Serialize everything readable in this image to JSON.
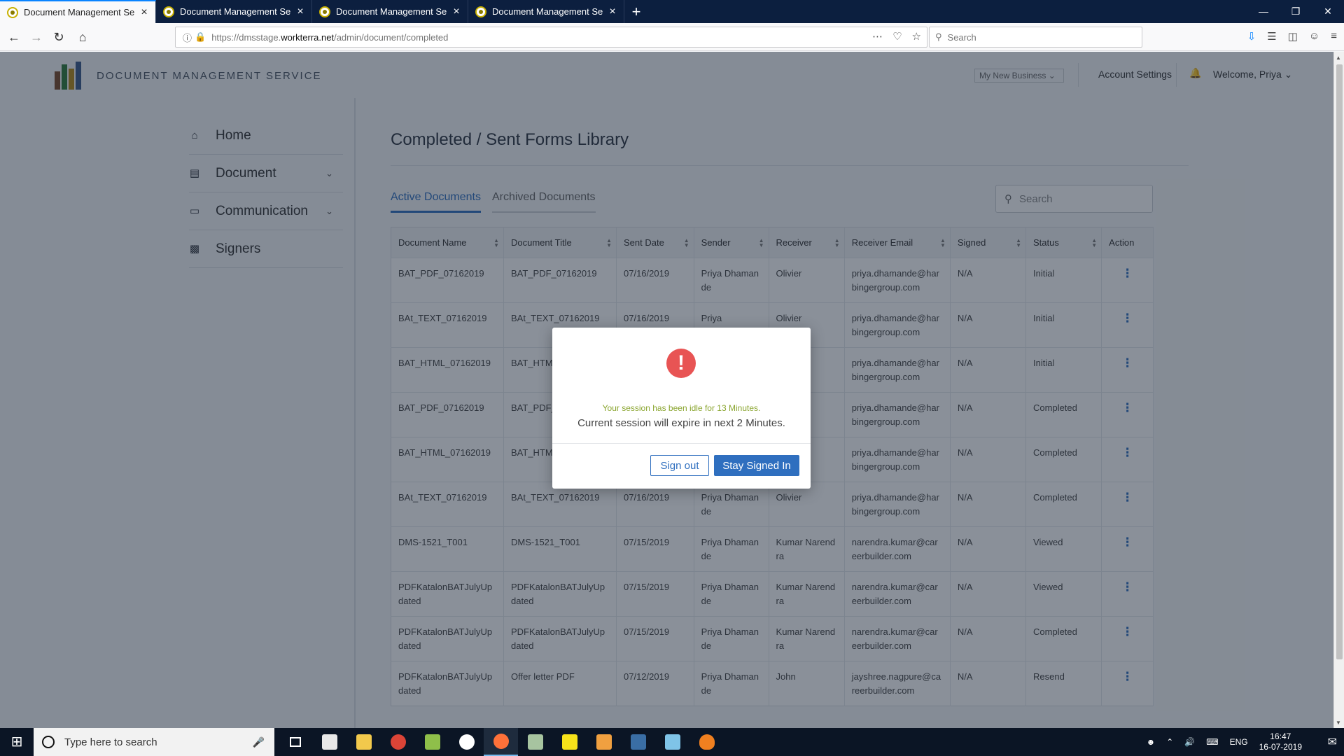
{
  "browser": {
    "tabs": [
      {
        "title": "Document Management Servic",
        "active": true
      },
      {
        "title": "Document Management Servic",
        "active": false
      },
      {
        "title": "Document Management Servic",
        "active": false
      },
      {
        "title": "Document Management Servic",
        "active": false
      }
    ],
    "url_prefix": "https://dmsstage.",
    "url_domain": "workterra.net",
    "url_path": "/admin/document/completed",
    "search_placeholder": "Search"
  },
  "app": {
    "brand": "DOCUMENT MANAGEMENT SERVICE",
    "business_selector": "My New Business",
    "account_settings": "Account Settings",
    "welcome": "Welcome, Priya"
  },
  "sidebar": {
    "items": [
      {
        "label": "Home",
        "icon": "home-icon",
        "expandable": false
      },
      {
        "label": "Document",
        "icon": "document-icon",
        "expandable": true
      },
      {
        "label": "Communication",
        "icon": "chat-icon",
        "expandable": true
      },
      {
        "label": "Signers",
        "icon": "id-card-icon",
        "expandable": false
      }
    ]
  },
  "main": {
    "title": "Completed / Sent Forms Library",
    "tabs": [
      {
        "label": "Active Documents",
        "active": true
      },
      {
        "label": "Archived Documents",
        "active": false
      }
    ],
    "search_placeholder": "Search",
    "columns": [
      "Document Name",
      "Document Title",
      "Sent Date",
      "Sender",
      "Receiver",
      "Receiver Email",
      "Signed",
      "Status",
      "Action"
    ],
    "rows": [
      [
        "BAT_PDF_07162019",
        "BAT_PDF_07162019",
        "07/16/2019",
        "Priya Dhamande",
        "Olivier",
        "priya.dhamande@harbingergroup.com",
        "N/A",
        "Initial"
      ],
      [
        "BAt_TEXT_07162019",
        "BAt_TEXT_07162019",
        "07/16/2019",
        "Priya",
        "Olivier",
        "priya.dhamande@harbingergroup.com",
        "N/A",
        "Initial"
      ],
      [
        "BAT_HTML_07162019",
        "BAT_HTM",
        "",
        "",
        "",
        "priya.dhamande@harbingergroup.com",
        "N/A",
        "Initial"
      ],
      [
        "BAT_PDF_07162019",
        "BAT_PDF_",
        "",
        "",
        "",
        "priya.dhamande@harbingergroup.com",
        "N/A",
        "Completed"
      ],
      [
        "BAT_HTML_07162019",
        "BAT_HTM",
        "",
        "",
        "",
        "priya.dhamande@harbingergroup.com",
        "N/A",
        "Completed"
      ],
      [
        "BAt_TEXT_07162019",
        "BAt_TEXT_07162019",
        "07/16/2019",
        "Priya Dhamande",
        "Olivier",
        "priya.dhamande@harbingergroup.com",
        "N/A",
        "Completed"
      ],
      [
        "DMS-1521_T001",
        "DMS-1521_T001",
        "07/15/2019",
        "Priya Dhamande",
        "Kumar Narendra",
        "narendra.kumar@careerbuilder.com",
        "N/A",
        "Viewed"
      ],
      [
        "PDFKatalonBATJulyUpdated",
        "PDFKatalonBATJulyUpdated",
        "07/15/2019",
        "Priya Dhamande",
        "Kumar Narendra",
        "narendra.kumar@careerbuilder.com",
        "N/A",
        "Viewed"
      ],
      [
        "PDFKatalonBATJulyUpdated",
        "PDFKatalonBATJulyUpdated",
        "07/15/2019",
        "Priya Dhamande",
        "Kumar Narendra",
        "narendra.kumar@careerbuilder.com",
        "N/A",
        "Completed"
      ],
      [
        "PDFKatalonBATJulyUpdated",
        "Offer letter PDF",
        "07/12/2019",
        "Priya Dhamande",
        "John",
        "jayshree.nagpure@careerbuilder.com",
        "N/A",
        "Resend"
      ]
    ]
  },
  "modal": {
    "idle_text": "Your session has been idle for 13 Minutes.",
    "expire_text": "Current session will expire in next 2 Minutes.",
    "sign_out": "Sign out",
    "stay_signed_in": "Stay Signed In"
  },
  "taskbar": {
    "search_placeholder": "Type here to search",
    "language": "ENG",
    "time": "16:47",
    "date": "16-07-2019"
  },
  "colors": {
    "accent": "#2f6fbf",
    "warning": "#e85454",
    "idle_text": "#8aa52f"
  }
}
